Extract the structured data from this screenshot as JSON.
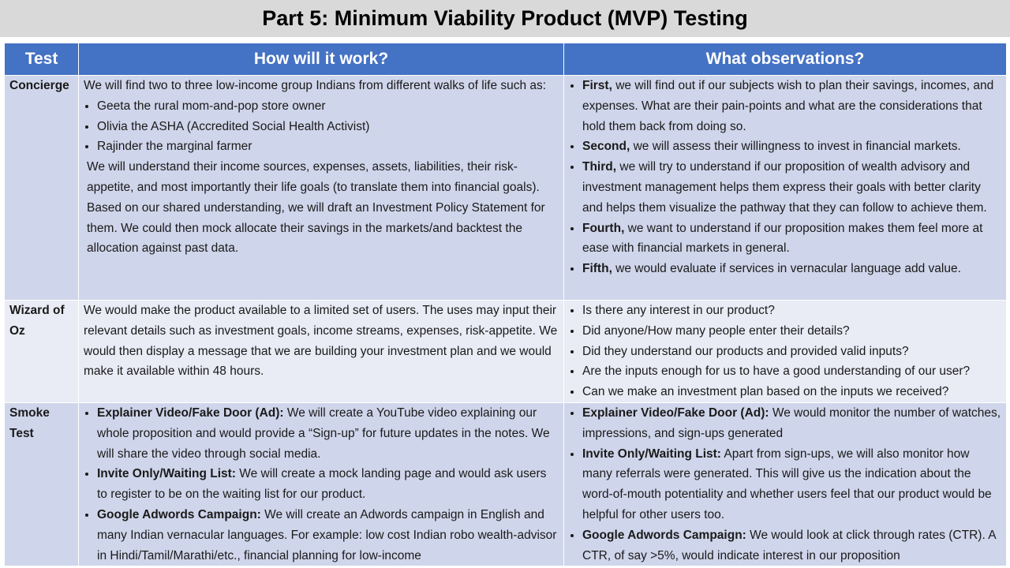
{
  "title": "Part 5: Minimum Viability Product (MVP) Testing",
  "columns": [
    "Test",
    "How will it work?",
    "What observations?"
  ],
  "rows": [
    {
      "test": "Concierge",
      "how_intro": "We will find two to three low-income group Indians from different walks of life such as:",
      "how_bullets": [
        "Geeta the rural mom-and-pop store owner",
        "Olivia the ASHA (Accredited Social Health Activist)",
        "Rajinder the marginal farmer"
      ],
      "how_outro": "We will understand their income sources, expenses, assets, liabilities, their risk-appetite, and most importantly their life goals (to translate them into financial goals). Based on our shared understanding, we will draft an Investment Policy Statement for them. We could then mock allocate their savings in the markets/and backtest the allocation against past data.",
      "observations": [
        {
          "lead": "First,",
          "text": " we will find out if our subjects wish to plan their savings, incomes, and expenses. What are their pain-points and what are the considerations that hold them back from doing so."
        },
        {
          "lead": "Second,",
          "text": " we will assess their willingness to invest in financial markets."
        },
        {
          "lead": "Third,",
          "text": " we will try to understand if our proposition of wealth advisory and investment management helps them express their goals with better clarity and helps them visualize the pathway that they can follow to achieve them."
        },
        {
          "lead": "Fourth,",
          "text": " we want to understand if our proposition makes them feel more at ease with financial markets in general."
        },
        {
          "lead": "Fifth,",
          "text": " we would evaluate if services in vernacular language add value."
        }
      ]
    },
    {
      "test": "Wizard of Oz",
      "how_text": "We would make the product available to a limited set of users. The uses may input their relevant details such as investment goals, income streams, expenses, risk-appetite. We would then display a message that we are building your investment plan and we would make it available within 48 hours.",
      "observations": [
        {
          "lead": "",
          "text": "Is there any interest in our product?"
        },
        {
          "lead": "",
          "text": "Did anyone/How many people enter their details?"
        },
        {
          "lead": "",
          "text": "Did they understand our products and provided valid inputs?"
        },
        {
          "lead": "",
          "text": "Are the inputs enough for us to have a good understanding of our user?"
        },
        {
          "lead": "",
          "text": "Can we make an investment plan based on the inputs we received?"
        }
      ]
    },
    {
      "test": "Smoke Test",
      "how_bullets": [
        {
          "lead": "Explainer Video/Fake Door (Ad):",
          "text": " We will create a YouTube video explaining our whole proposition and would provide a “Sign-up” for future updates in the notes. We will share the video through social media."
        },
        {
          "lead": "Invite Only/Waiting List:",
          "text": " We will create a mock landing page and would ask users to register to be on the waiting list for our product."
        },
        {
          "lead": "Google Adwords Campaign:",
          "text": " We will create an Adwords campaign in English and many Indian vernacular languages. For example: low cost Indian robo wealth-advisor in Hindi/Tamil/Marathi/etc., financial planning for low-income"
        }
      ],
      "observations": [
        {
          "lead": "Explainer Video/Fake Door (Ad):",
          "text": " We would monitor the number of watches, impressions, and sign-ups generated"
        },
        {
          "lead": "Invite Only/Waiting List:",
          "text": " Apart from sign-ups, we will also monitor how many referrals were generated. This will give us the indication about the word-of-mouth potentiality and whether users feel that our product would be helpful for other users too."
        },
        {
          "lead": "Google Adwords Campaign:",
          "text": "  We would look at click through rates (CTR). A CTR, of say >5%, would indicate interest in our proposition"
        }
      ]
    }
  ]
}
